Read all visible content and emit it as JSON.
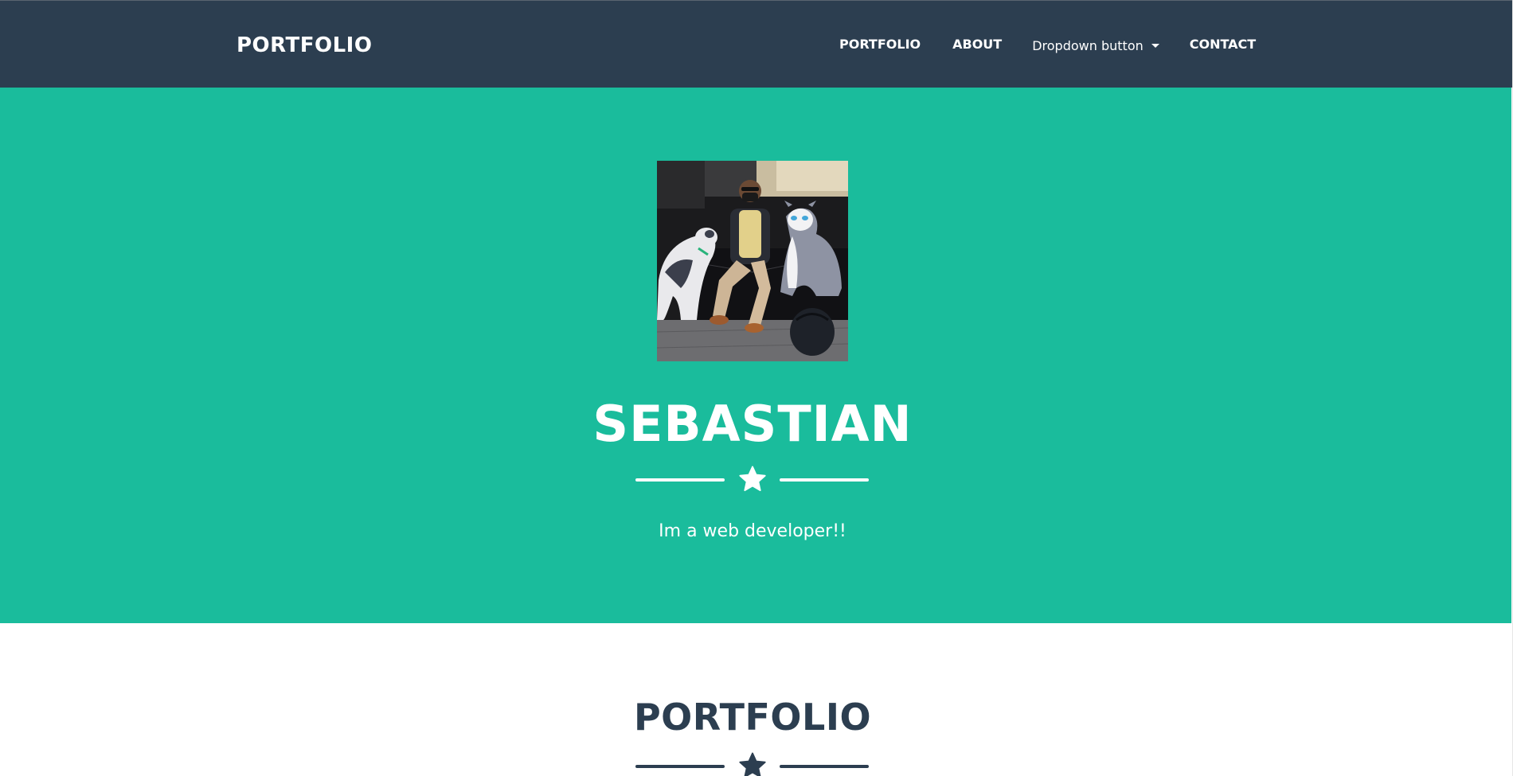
{
  "colors": {
    "navbar_bg": "#2c3e50",
    "hero_bg": "#1abc9c",
    "text_light": "#ffffff",
    "text_dark": "#2c3e50"
  },
  "navbar": {
    "brand": "PORTFOLIO",
    "links": {
      "portfolio": "PORTFOLIO",
      "about": "ABOUT",
      "dropdown": "Dropdown button",
      "contact": "CONTACT"
    }
  },
  "hero": {
    "name": "SEBASTIAN",
    "subtitle": "Im a web developer!!",
    "divider_icon": "star-icon"
  },
  "portfolio_section": {
    "title": "PORTFOLIO",
    "divider_icon": "star-icon"
  }
}
